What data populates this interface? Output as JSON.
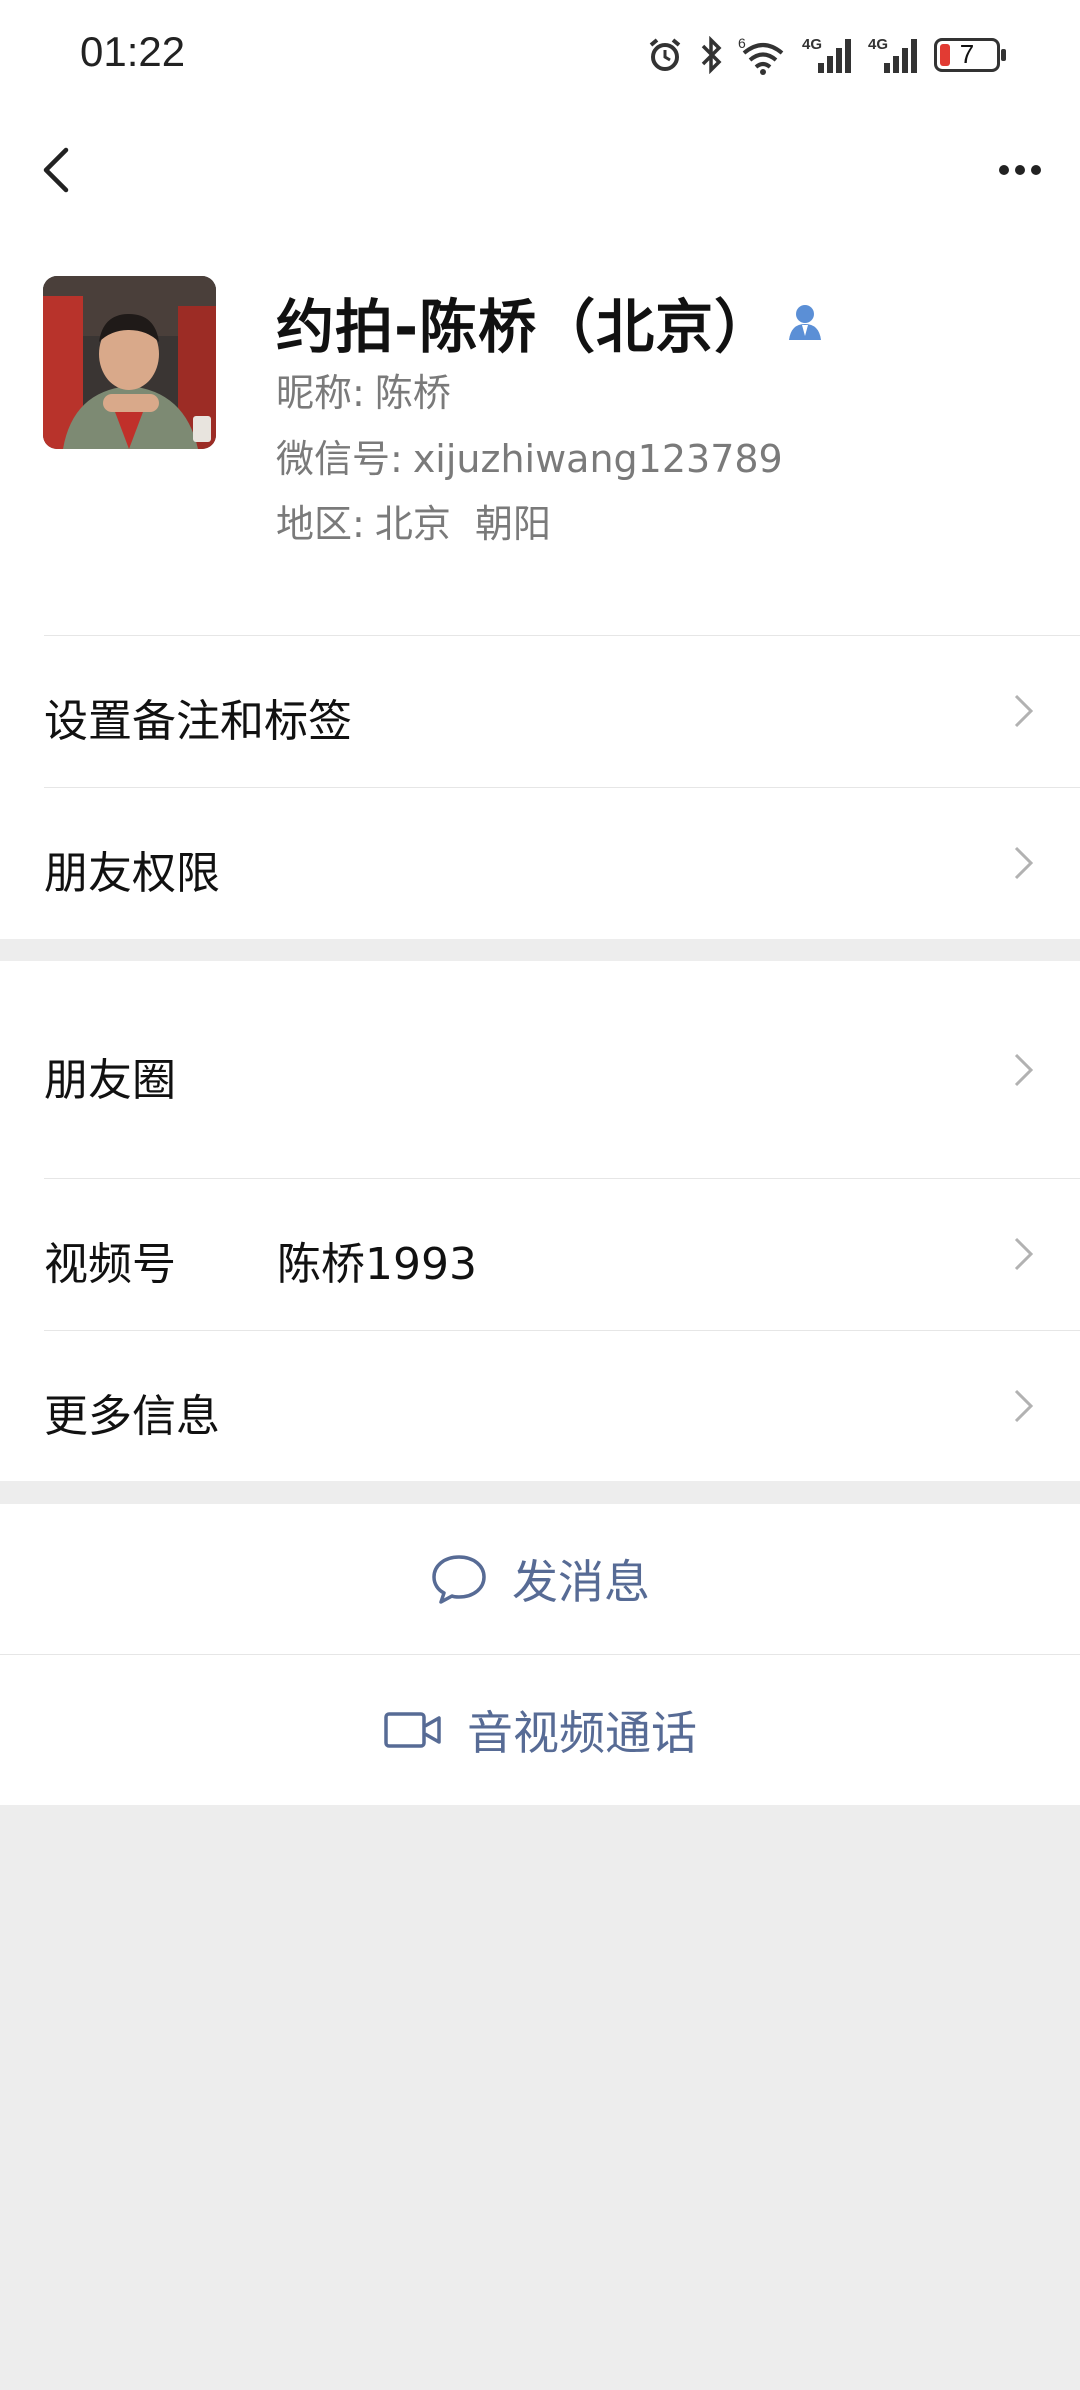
{
  "status_bar": {
    "time": "01:22",
    "battery_level": "7",
    "icons": [
      "alarm-icon",
      "bluetooth-icon",
      "wifi-6-icon",
      "signal-4g-icon",
      "signal-4g-icon",
      "battery-icon"
    ],
    "network_1": "4G",
    "network_2": "4G",
    "wifi_badge": "6"
  },
  "navbar": {
    "back_icon": "chevron-left-icon",
    "more_icon": "more-dots-icon"
  },
  "profile": {
    "display_name": "约拍-陈桥（北京）",
    "nickname_label": "昵称:",
    "nickname": "陈桥",
    "wechat_id_label": "微信号:",
    "wechat_id": "xijuzhiwang123789",
    "region_label": "地区:",
    "region": "北京  朝阳",
    "verified_icon": "contact-person-icon"
  },
  "menu": {
    "remark_tags": "设置备注和标签",
    "friend_permissions": "朋友权限",
    "moments": "朋友圈",
    "channels_label": "视频号",
    "channels_value": "陈桥1993",
    "more_info": "更多信息"
  },
  "actions": {
    "send_message": "发消息",
    "video_call": "音视频通话"
  },
  "colors": {
    "link": "#576b95",
    "background": "#ededed",
    "battery_low": "#e23b33"
  }
}
